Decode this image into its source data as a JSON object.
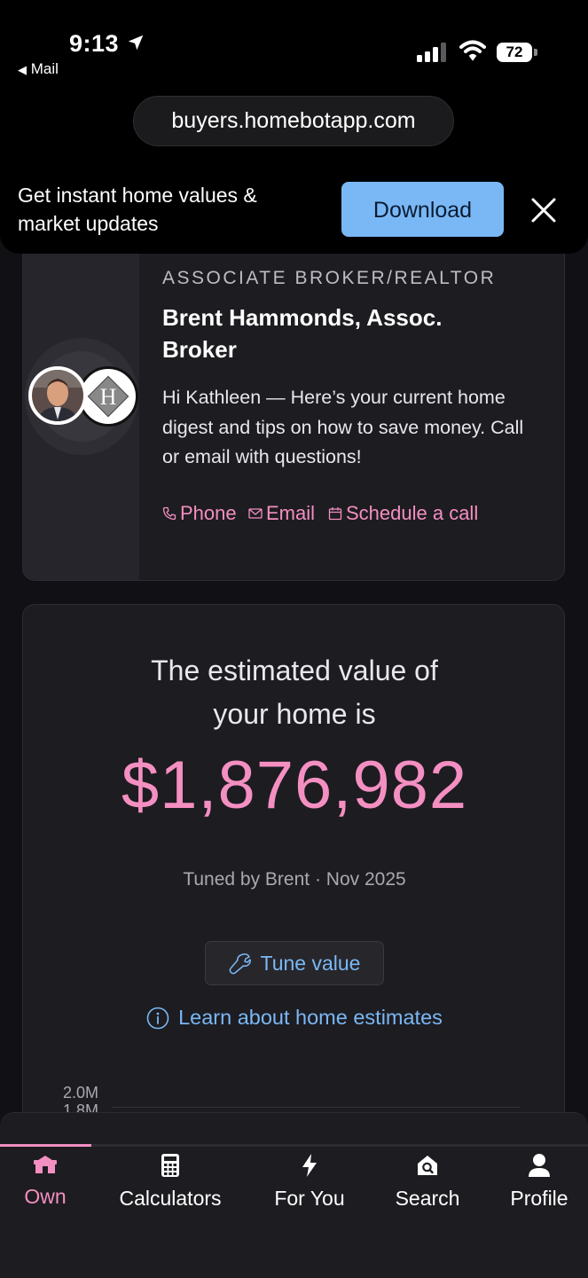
{
  "status_bar": {
    "time": "9:13",
    "back_label": "Mail",
    "battery": "72"
  },
  "browser": {
    "url": "buyers.homebotapp.com"
  },
  "banner": {
    "text": "Get instant home values & market updates",
    "download_label": "Download"
  },
  "agent": {
    "role": "ASSOCIATE BROKER/REALTOR",
    "name": "Brent Hammonds, Assoc. Broker",
    "greeting": "Hi Kathleen — Here’s your current home digest and tips on how to save money. Call or email with questions!",
    "contacts": {
      "phone": "Phone",
      "email": "Email",
      "schedule": "Schedule a call"
    },
    "logo_text": "H"
  },
  "estimate": {
    "heading": "The estimated value of your home is",
    "value": "$1,876,982",
    "tuned_by": "Tuned by Brent · Nov 2025",
    "tune_label": "Tune value",
    "learn_label": "Learn about home estimates",
    "axis": {
      "y_top": "2.0M",
      "y_next": "1.8M"
    }
  },
  "nav": {
    "progress": 0.155,
    "items": [
      {
        "label": "Own",
        "icon": "home-icon",
        "active": true
      },
      {
        "label": "Calculators",
        "icon": "calculator-icon",
        "active": false
      },
      {
        "label": "For You",
        "icon": "bolt-icon",
        "active": false
      },
      {
        "label": "Search",
        "icon": "search-home-icon",
        "active": false
      },
      {
        "label": "Profile",
        "icon": "user-icon",
        "active": false
      }
    ]
  },
  "colors": {
    "accent_pink": "#f48fc1",
    "accent_blue": "#7ab8f5",
    "card_bg": "#1d1c21",
    "page_bg": "#111014"
  }
}
